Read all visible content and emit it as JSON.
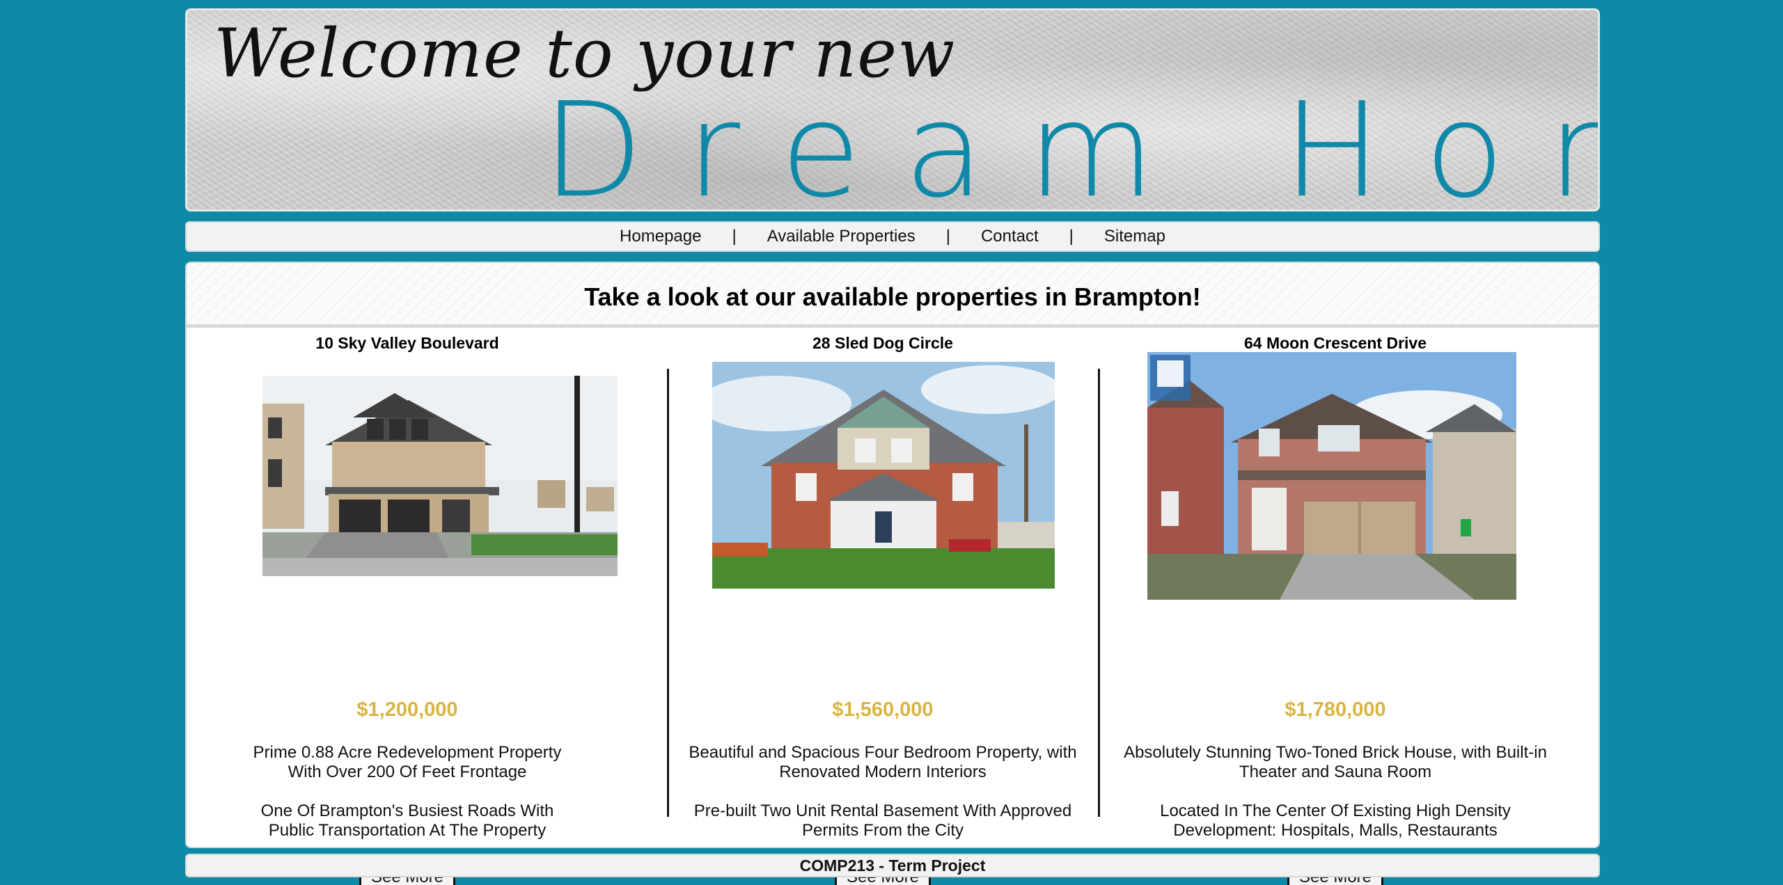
{
  "header": {
    "welcome": "Welcome to your new",
    "brand": "Dream Home"
  },
  "nav": {
    "items": [
      {
        "label": "Homepage"
      },
      {
        "label": "Available Properties"
      },
      {
        "label": "Contact"
      },
      {
        "label": "Sitemap"
      }
    ],
    "separator": "|"
  },
  "main": {
    "heading": "Take a look at our available properties in Brampton!",
    "properties": [
      {
        "title": "10 Sky Valley Boulevard",
        "price": "$1,200,000",
        "desc1": "Prime 0.88 Acre Redevelopment Property With Over 200 Of Feet Frontage",
        "desc2": "One Of Brampton's Busiest Roads With Public Transportation At The Property",
        "button": "See More"
      },
      {
        "title": "28 Sled Dog Circle",
        "price": "$1,560,000",
        "desc1": "Beautiful and Spacious Four Bedroom Property, with Renovated Modern Interiors",
        "desc2": "Pre-built Two Unit Rental Basement With Approved Permits From the City",
        "button": "See More"
      },
      {
        "title": "64 Moon Crescent Drive",
        "price": "$1,780,000",
        "desc1": "Absolutely Stunning Two-Toned Brick House, with Built-in Theater and Sauna Room",
        "desc2": "Located In The Center Of Existing High Density Development: Hospitals, Malls, Restaurants",
        "button": "See More"
      }
    ]
  },
  "footer": {
    "text": "COMP213 - Term Project"
  },
  "colors": {
    "background": "#0f8aa6",
    "brand_teal": "#1089a8",
    "price_gold": "#d9b440"
  }
}
